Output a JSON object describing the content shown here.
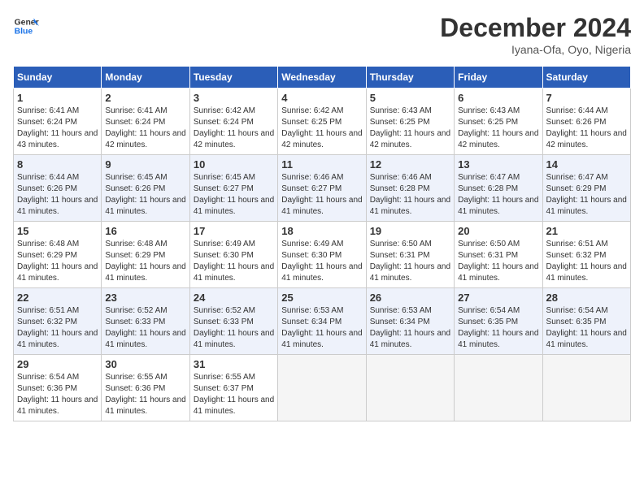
{
  "header": {
    "logo_line1": "General",
    "logo_line2": "Blue",
    "month": "December 2024",
    "location": "Iyana-Ofa, Oyo, Nigeria"
  },
  "weekdays": [
    "Sunday",
    "Monday",
    "Tuesday",
    "Wednesday",
    "Thursday",
    "Friday",
    "Saturday"
  ],
  "weeks": [
    [
      {
        "day": 1,
        "sunrise": "6:41 AM",
        "sunset": "6:24 PM",
        "daylight": "11 hours and 43 minutes."
      },
      {
        "day": 2,
        "sunrise": "6:41 AM",
        "sunset": "6:24 PM",
        "daylight": "11 hours and 42 minutes."
      },
      {
        "day": 3,
        "sunrise": "6:42 AM",
        "sunset": "6:24 PM",
        "daylight": "11 hours and 42 minutes."
      },
      {
        "day": 4,
        "sunrise": "6:42 AM",
        "sunset": "6:25 PM",
        "daylight": "11 hours and 42 minutes."
      },
      {
        "day": 5,
        "sunrise": "6:43 AM",
        "sunset": "6:25 PM",
        "daylight": "11 hours and 42 minutes."
      },
      {
        "day": 6,
        "sunrise": "6:43 AM",
        "sunset": "6:25 PM",
        "daylight": "11 hours and 42 minutes."
      },
      {
        "day": 7,
        "sunrise": "6:44 AM",
        "sunset": "6:26 PM",
        "daylight": "11 hours and 42 minutes."
      }
    ],
    [
      {
        "day": 8,
        "sunrise": "6:44 AM",
        "sunset": "6:26 PM",
        "daylight": "11 hours and 41 minutes."
      },
      {
        "day": 9,
        "sunrise": "6:45 AM",
        "sunset": "6:26 PM",
        "daylight": "11 hours and 41 minutes."
      },
      {
        "day": 10,
        "sunrise": "6:45 AM",
        "sunset": "6:27 PM",
        "daylight": "11 hours and 41 minutes."
      },
      {
        "day": 11,
        "sunrise": "6:46 AM",
        "sunset": "6:27 PM",
        "daylight": "11 hours and 41 minutes."
      },
      {
        "day": 12,
        "sunrise": "6:46 AM",
        "sunset": "6:28 PM",
        "daylight": "11 hours and 41 minutes."
      },
      {
        "day": 13,
        "sunrise": "6:47 AM",
        "sunset": "6:28 PM",
        "daylight": "11 hours and 41 minutes."
      },
      {
        "day": 14,
        "sunrise": "6:47 AM",
        "sunset": "6:29 PM",
        "daylight": "11 hours and 41 minutes."
      }
    ],
    [
      {
        "day": 15,
        "sunrise": "6:48 AM",
        "sunset": "6:29 PM",
        "daylight": "11 hours and 41 minutes."
      },
      {
        "day": 16,
        "sunrise": "6:48 AM",
        "sunset": "6:29 PM",
        "daylight": "11 hours and 41 minutes."
      },
      {
        "day": 17,
        "sunrise": "6:49 AM",
        "sunset": "6:30 PM",
        "daylight": "11 hours and 41 minutes."
      },
      {
        "day": 18,
        "sunrise": "6:49 AM",
        "sunset": "6:30 PM",
        "daylight": "11 hours and 41 minutes."
      },
      {
        "day": 19,
        "sunrise": "6:50 AM",
        "sunset": "6:31 PM",
        "daylight": "11 hours and 41 minutes."
      },
      {
        "day": 20,
        "sunrise": "6:50 AM",
        "sunset": "6:31 PM",
        "daylight": "11 hours and 41 minutes."
      },
      {
        "day": 21,
        "sunrise": "6:51 AM",
        "sunset": "6:32 PM",
        "daylight": "11 hours and 41 minutes."
      }
    ],
    [
      {
        "day": 22,
        "sunrise": "6:51 AM",
        "sunset": "6:32 PM",
        "daylight": "11 hours and 41 minutes."
      },
      {
        "day": 23,
        "sunrise": "6:52 AM",
        "sunset": "6:33 PM",
        "daylight": "11 hours and 41 minutes."
      },
      {
        "day": 24,
        "sunrise": "6:52 AM",
        "sunset": "6:33 PM",
        "daylight": "11 hours and 41 minutes."
      },
      {
        "day": 25,
        "sunrise": "6:53 AM",
        "sunset": "6:34 PM",
        "daylight": "11 hours and 41 minutes."
      },
      {
        "day": 26,
        "sunrise": "6:53 AM",
        "sunset": "6:34 PM",
        "daylight": "11 hours and 41 minutes."
      },
      {
        "day": 27,
        "sunrise": "6:54 AM",
        "sunset": "6:35 PM",
        "daylight": "11 hours and 41 minutes."
      },
      {
        "day": 28,
        "sunrise": "6:54 AM",
        "sunset": "6:35 PM",
        "daylight": "11 hours and 41 minutes."
      }
    ],
    [
      {
        "day": 29,
        "sunrise": "6:54 AM",
        "sunset": "6:36 PM",
        "daylight": "11 hours and 41 minutes."
      },
      {
        "day": 30,
        "sunrise": "6:55 AM",
        "sunset": "6:36 PM",
        "daylight": "11 hours and 41 minutes."
      },
      {
        "day": 31,
        "sunrise": "6:55 AM",
        "sunset": "6:37 PM",
        "daylight": "11 hours and 41 minutes."
      },
      null,
      null,
      null,
      null
    ]
  ]
}
